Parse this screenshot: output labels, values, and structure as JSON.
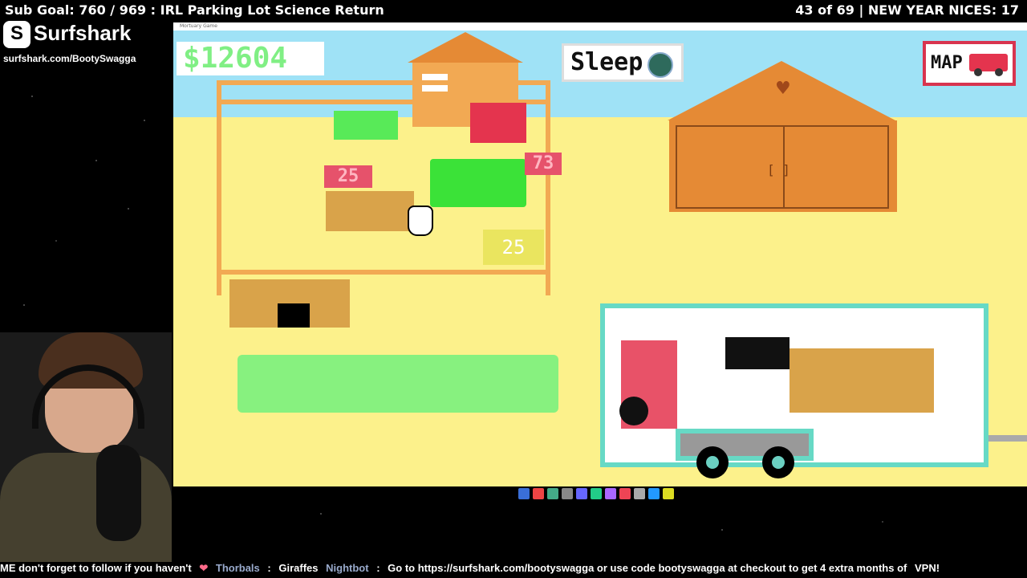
{
  "stream": {
    "sub_goal": "Sub Goal: 760 / 969 : IRL Parking Lot Science Return",
    "progress": "43 of 69 | NEW YEAR NICES: 17",
    "sponsor_name": "Surfshark",
    "sponsor_url": "surfshark.com/BootySwagga"
  },
  "game": {
    "window_title": "Mortuary Game",
    "money": "$12604",
    "sleep_label": "Sleep",
    "map_label": "MAP",
    "tag_left": "25",
    "tag_right": "73",
    "price": "25",
    "barn_label": "[ ]"
  },
  "ticker": {
    "msg1": "ME don't forget to follow if you haven't",
    "user1": "Thorbals",
    "text1": "Giraffes",
    "user2": "Nightbot",
    "text2": "Go to https://surfshark.com/bootyswagga or use code bootyswagga at checkout to get 4 extra months of",
    "text3": "VPN!"
  }
}
